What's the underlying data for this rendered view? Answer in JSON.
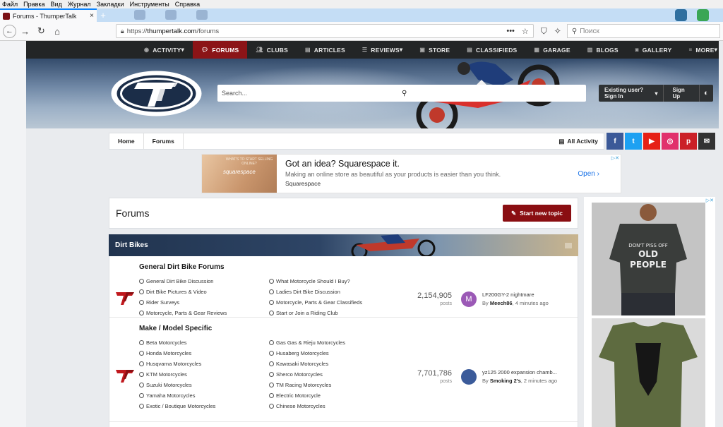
{
  "browser": {
    "menu": [
      "Файл",
      "Правка",
      "Вид",
      "Журнал",
      "Закладки",
      "Инструменты",
      "Справка"
    ],
    "tab_title": "Forums - ThumperTalk",
    "tab_close": "×",
    "new_tab": "+",
    "url_prefix": "https://",
    "url_domain": "thumpertalk.com",
    "url_path": "/forums",
    "search_placeholder": "Поиск"
  },
  "site": {
    "nav": [
      {
        "label": "ACTIVITY",
        "icon": "rss-icon",
        "caret": true
      },
      {
        "label": "FORUMS",
        "icon": "comments-icon",
        "active": true
      },
      {
        "label": "CLUBS",
        "icon": "users-icon"
      },
      {
        "label": "ARTICLES",
        "icon": "file-icon"
      },
      {
        "label": "REVIEWS",
        "icon": "list-icon",
        "caret": true
      },
      {
        "label": "STORE",
        "icon": "store-icon"
      },
      {
        "label": "CLASSIFIEDS",
        "icon": "tag-icon"
      },
      {
        "label": "GARAGE",
        "icon": "garage-icon"
      },
      {
        "label": "BLOGS",
        "icon": "blog-icon"
      },
      {
        "label": "GALLERY",
        "icon": "camera-icon"
      },
      {
        "label": "MORE",
        "icon": "menu-icon",
        "caret": true
      }
    ],
    "search_placeholder": "Search...",
    "signin": "Existing user? Sign In",
    "signup": "Sign Up"
  },
  "breadcrumb": {
    "home": "Home",
    "current": "Forums",
    "all_activity": "All Activity"
  },
  "social": [
    {
      "name": "facebook",
      "glyph": "f",
      "color": "#3b5998"
    },
    {
      "name": "twitter",
      "glyph": "t",
      "color": "#1da1f2"
    },
    {
      "name": "youtube",
      "glyph": "▶",
      "color": "#e62117"
    },
    {
      "name": "instagram",
      "glyph": "◎",
      "color": "#e1306c"
    },
    {
      "name": "pinterest",
      "glyph": "p",
      "color": "#cb2027"
    },
    {
      "name": "email",
      "glyph": "✉",
      "color": "#333333"
    }
  ],
  "ad_top": {
    "headline": "Got an idea? Squarespace it.",
    "desc": "Making an online store as beautiful as your products is easier than you think.",
    "brand": "Squarespace",
    "cta": "Open",
    "img_text": "WHAT'S TO START SELLING ONLINE?",
    "img_brand": "squarespace"
  },
  "forums": {
    "title": "Forums",
    "start_topic": "Start new topic",
    "category": "Dirt Bikes",
    "rows": [
      {
        "title": "General Dirt Bike Forums",
        "subs": [
          "General Dirt Bike Discussion",
          "What Motorcycle Should I Buy?",
          "Dirt Bike Pictures & Video",
          "Ladies Dirt Bike Discussion",
          "Rider Surveys",
          "Motorcycle, Parts & Gear Classifieds",
          "Motorcycle, Parts & Gear Reviews",
          "Start or Join a Riding Club"
        ],
        "posts": "2,154,905",
        "posts_label": "posts",
        "last_title": "LF200GY-2 nightmare",
        "last_by": "By",
        "last_user": "Meech86",
        "last_time": "4 minutes ago",
        "avatar": "M",
        "avatar_color": "#9b59b6"
      },
      {
        "title": "Make / Model Specific",
        "subs": [
          "Beta Motorcycles",
          "Gas Gas & Rieju Motorcycles",
          "Honda Motorcycles",
          "Husaberg Motorcycles",
          "Husqvarna Motorcycles",
          "Kawasaki Motorcycles",
          "KTM Motorcycles",
          "Sherco Motorcycles",
          "Suzuki Motorcycles",
          "TM Racing Motorcycles",
          "Yamaha Motorcycles",
          "Electric Motorcycle",
          "Exotic / Boutique Motorcycles",
          "Chinese Motorcycles"
        ],
        "posts": "7,701,786",
        "posts_label": "posts",
        "last_title": "yz125 2000 expansion chamb...",
        "last_by": "By",
        "last_user": "Smoking 2's",
        "last_time": "2 minutes ago",
        "avatar": "",
        "avatar_color": "#3b5b9a"
      }
    ]
  }
}
